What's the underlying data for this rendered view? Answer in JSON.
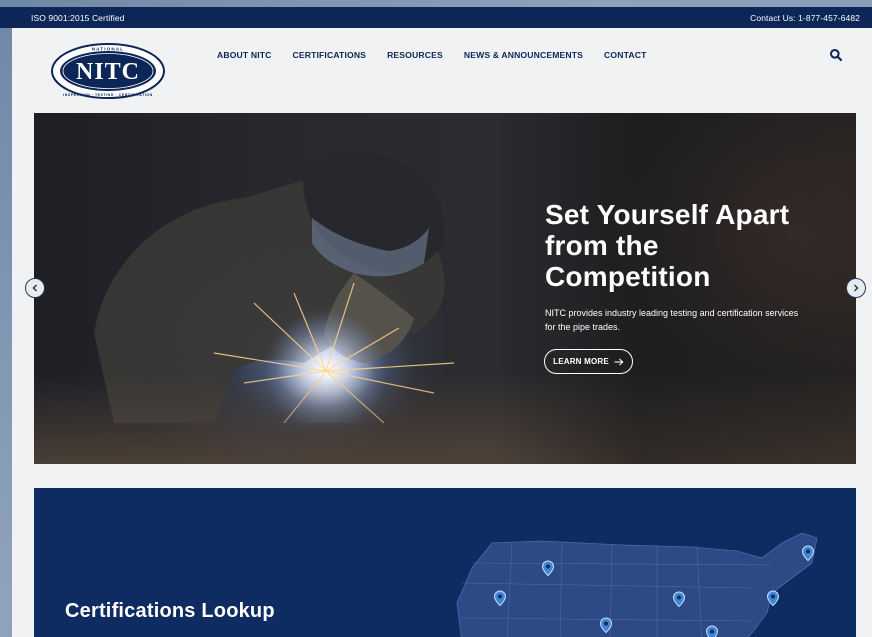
{
  "topbar": {
    "certification_text": "ISO 9001:2015 Certified",
    "contact_text": "Contact Us: 1-877-457-6482"
  },
  "logo": {
    "main_text": "NITC",
    "top_text": "NATIONAL",
    "ring_text": "INSPECTION · TESTING · CERTIFICATION"
  },
  "nav": {
    "items": [
      {
        "label": "ABOUT NITC"
      },
      {
        "label": "CERTIFICATIONS"
      },
      {
        "label": "RESOURCES"
      },
      {
        "label": "NEWS & ANNOUNCEMENTS"
      },
      {
        "label": "CONTACT"
      }
    ],
    "search_icon": "search-icon"
  },
  "hero": {
    "title": "Set Yourself Apart from the Competition",
    "description": "NITC provides industry leading testing and certification services for the pipe trades.",
    "button_label": "LEARN MORE",
    "button_icon": "arrow-right-icon",
    "prev_icon": "chevron-left-icon",
    "next_icon": "chevron-right-icon"
  },
  "lookup": {
    "title": "Certifications Lookup",
    "map_icon": "location-pin-icon"
  },
  "colors": {
    "navy": "#0c2657",
    "lookup_bg": "#0e2b62",
    "page_bg": "#f1f2f4",
    "pin_blue": "#3f86d6"
  }
}
